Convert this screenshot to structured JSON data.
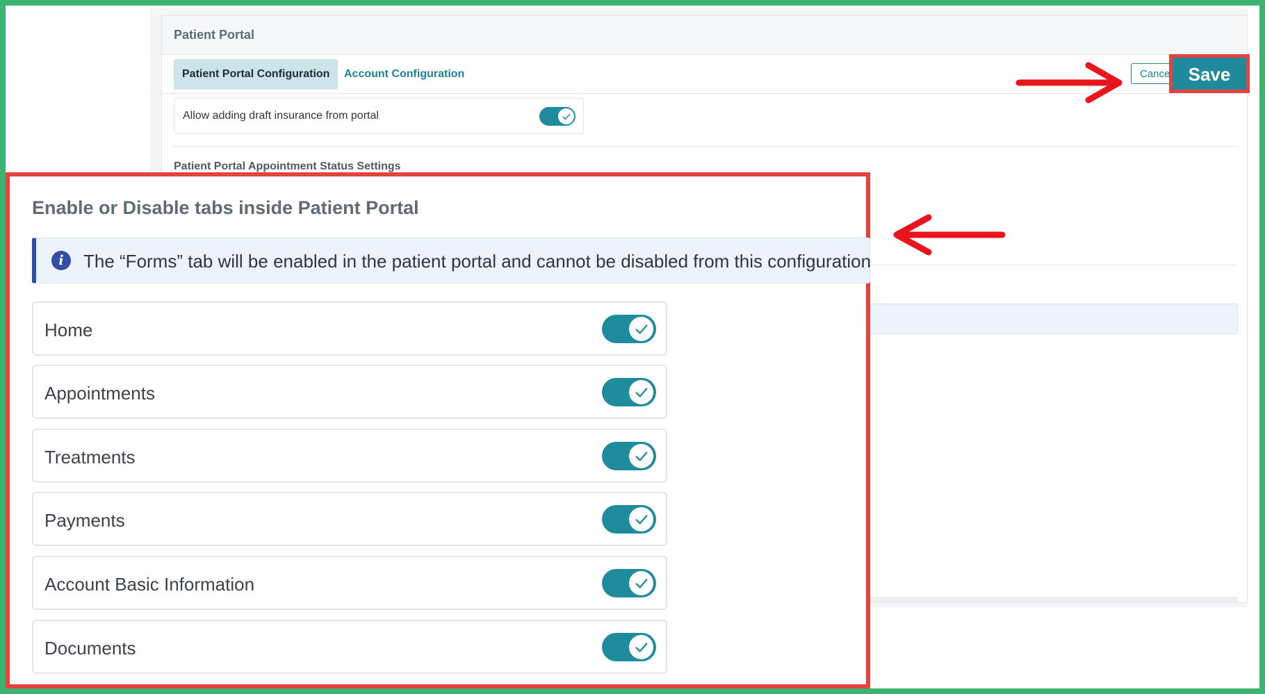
{
  "page": {
    "title": "Patient Portal",
    "tabs": [
      {
        "label": "Patient Portal Configuration",
        "active": true
      },
      {
        "label": "Account Configuration",
        "active": false
      }
    ],
    "actions": {
      "cancel_label": "Cance",
      "save_label": "Save"
    },
    "draft_insurance": {
      "label": "Allow adding draft insurance from portal",
      "enabled": true
    },
    "status_settings_title": "Patient Portal Appointment Status Settings"
  },
  "zoom_panel": {
    "title": "Enable or Disable tabs inside Patient Portal",
    "info_text": "The “Forms” tab will be enabled in the patient portal and cannot be disabled from this configuration",
    "tabs": [
      {
        "label": "Home",
        "enabled": true
      },
      {
        "label": "Appointments",
        "enabled": true
      },
      {
        "label": "Treatments",
        "enabled": true
      },
      {
        "label": "Payments",
        "enabled": true
      },
      {
        "label": "Account Basic Information",
        "enabled": true
      },
      {
        "label": "Documents",
        "enabled": true
      }
    ]
  },
  "colors": {
    "accent": "#1f8c9e",
    "annotation_red": "#e8423f",
    "frame_green": "#3cb371",
    "info_blue": "#2e4ea8"
  },
  "icons": [
    "check-icon",
    "info-icon",
    "arrow-right-icon",
    "arrow-left-icon"
  ]
}
